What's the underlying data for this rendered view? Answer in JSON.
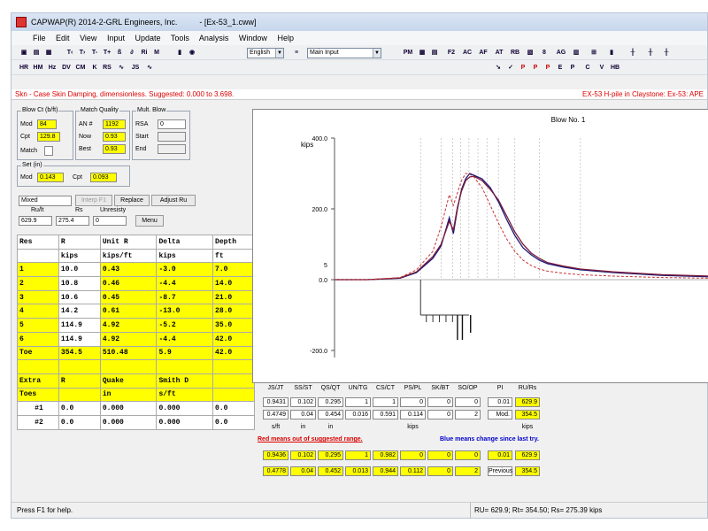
{
  "window": {
    "title": "CAPWAP(R) 2014-2-GRL Engineers, Inc.",
    "doc": "- [Ex-53_1.cww]"
  },
  "menu": [
    "File",
    "Edit",
    "View",
    "Input",
    "Update",
    "Tools",
    "Analysis",
    "Window",
    "Help"
  ],
  "toolbar": {
    "language": "English",
    "mode": "Main Input",
    "buttons": [
      "PM",
      "F2",
      "AC",
      "AF",
      "AT",
      "RB",
      "AG",
      "C",
      "V"
    ]
  },
  "info_strip": {
    "left": "Skn - Case Skin Damping, dimensionless. Suggested: 0.000 to 3.698.",
    "right": "EX-53 H-pile in Claystone: Ex-53: APE"
  },
  "blow_ct": {
    "label": "Blow Ct (b/ft)",
    "mod_label": "Mod",
    "mod": "84",
    "cpt_label": "Cpt",
    "cpt": "129.8",
    "match_label": "Match"
  },
  "match_quality": {
    "label": "Match Quality",
    "an_label": "AN #",
    "an": "1192",
    "now_label": "Now",
    "now": "0.93",
    "best_label": "Best",
    "best": "0.93"
  },
  "mult_blow": {
    "label": "Mult. Blow",
    "rsa_label": "RSA",
    "rsa": "0",
    "start_label": "Start",
    "end_label": "End"
  },
  "set_in": {
    "label": "Set (in)",
    "mod_label": "Mod",
    "mod": "0.143",
    "cpt_label": "Cpt",
    "cpt": "0.093"
  },
  "controls": {
    "mode": "Mixed",
    "interp": "Interp F1",
    "replace": "Replace",
    "adjust": "Adjust Ru",
    "menu": "Menu",
    "hdr_ru": "Ru/lt",
    "hdr_rs": "Rs",
    "hdr_unresist": "Unresisty",
    "ru": "629.9",
    "rs": "275.4",
    "un": "0"
  },
  "res_table": {
    "headers": [
      "Res",
      "R",
      "Unit R",
      "Delta",
      "Depth"
    ],
    "units": [
      "",
      "kips",
      "kips/ft",
      "kips",
      "ft"
    ],
    "rows": [
      [
        "1",
        "10.0",
        "0.43",
        "-3.0",
        "7.0"
      ],
      [
        "2",
        "10.8",
        "0.46",
        "-4.4",
        "14.0"
      ],
      [
        "3",
        "10.6",
        "0.45",
        "-8.7",
        "21.0"
      ],
      [
        "4",
        "14.2",
        "0.61",
        "-13.0",
        "28.0"
      ],
      [
        "5",
        "114.9",
        "4.92",
        "-5.2",
        "35.0"
      ],
      [
        "6",
        "114.9",
        "4.92",
        "-4.4",
        "42.0"
      ]
    ],
    "toe": [
      "Toe",
      "354.5",
      "510.48",
      "5.9",
      "42.0"
    ],
    "extra_headers": [
      "Extra",
      "R",
      "Quake",
      "Smith D"
    ],
    "extra_units": [
      "Toes",
      "",
      "in",
      "s/ft"
    ],
    "extra_rows": [
      [
        "#1",
        "0.0",
        "0.000",
        "0.000",
        "0.0"
      ],
      [
        "#2",
        "0.0",
        "0.000",
        "0.000",
        "0.0"
      ]
    ]
  },
  "chart_data": {
    "type": "line",
    "title": "Blow No. 1",
    "ylabel": "kips",
    "ylim": [
      -200,
      400
    ],
    "yticks": [
      "400.0",
      "200.0",
      "0.0",
      "-200.0"
    ],
    "annotation": "5",
    "x": [
      0,
      4,
      8,
      10,
      12,
      13,
      14,
      14.5,
      15,
      15.5,
      16,
      16.5,
      17,
      18,
      19,
      20,
      21,
      22,
      23,
      24,
      25,
      26,
      28,
      30,
      34,
      40,
      46
    ],
    "series": [
      {
        "color": "#1a1a7a",
        "values": [
          0,
          0,
          4,
          20,
          60,
          95,
          175,
          130,
          200,
          255,
          285,
          300,
          295,
          285,
          260,
          220,
          170,
          125,
          90,
          70,
          55,
          45,
          35,
          28,
          20,
          12,
          8
        ]
      },
      {
        "color": "#7a1a3a",
        "values": [
          0,
          0,
          5,
          22,
          65,
          100,
          165,
          140,
          205,
          250,
          280,
          290,
          292,
          280,
          255,
          225,
          180,
          135,
          100,
          75,
          60,
          48,
          38,
          30,
          22,
          14,
          10
        ]
      },
      {
        "color": "#cc3333",
        "values": [
          0,
          0,
          6,
          28,
          80,
          150,
          240,
          210,
          245,
          280,
          300,
          298,
          290,
          260,
          210,
          160,
          115,
          80,
          55,
          40,
          30,
          24,
          18,
          14,
          10,
          6,
          4
        ]
      }
    ]
  },
  "params": {
    "headers": [
      "JS/JT",
      "SS/ST",
      "QS/QT",
      "UN/TG",
      "CS/CT",
      "PS/PL",
      "SK/BT",
      "SO/OP",
      "PI",
      "RU/Rs"
    ],
    "row1": [
      "0.9431",
      "0.102",
      "0.295",
      "1",
      "1",
      "0",
      "0",
      "0",
      "0.01",
      "629.9"
    ],
    "row2": [
      "0.4749",
      "0.04",
      "0.454",
      "0.016",
      "0.591",
      "0.114",
      "0",
      "2",
      "Mod.",
      "354.5"
    ],
    "units": [
      "s/ft",
      "in",
      "in",
      "",
      "",
      "kips",
      "",
      "",
      "",
      "kips"
    ],
    "red_note": "Red means out of suggested range.",
    "blue_note": "Blue means change since last try.",
    "row3": [
      "0.9436",
      "0.102",
      "0.295",
      "1",
      "0.982",
      "0",
      "0",
      "0",
      "0.01",
      "629.9"
    ],
    "row4": [
      "0.4778",
      "0.04",
      "0.452",
      "0.013",
      "0.944",
      "0.112",
      "0",
      "2",
      "Previous",
      "354.5"
    ]
  },
  "status": {
    "left": "Press F1 for help.",
    "right": "RU= 629.9; Rt= 354.50; Rs= 275.39 kips"
  }
}
